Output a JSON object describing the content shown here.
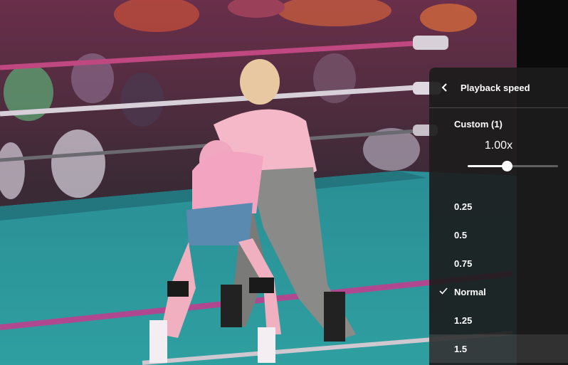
{
  "menu": {
    "title": "Playback speed",
    "custom_label": "Custom (1)",
    "custom_value": "1.00x",
    "slider_fraction": 0.43,
    "selected_index": 3,
    "hover_index": 5,
    "options": [
      {
        "label": "0.25"
      },
      {
        "label": "0.5"
      },
      {
        "label": "0.75"
      },
      {
        "label": "Normal"
      },
      {
        "label": "1.25"
      },
      {
        "label": "1.5"
      }
    ]
  },
  "icons": {
    "back": "chevron-left-icon",
    "check": "checkmark-icon"
  }
}
